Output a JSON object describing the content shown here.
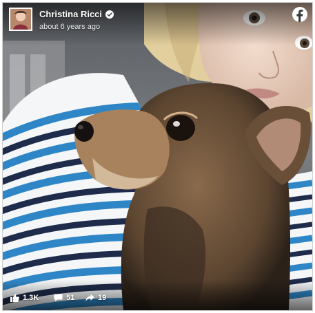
{
  "post": {
    "author_name": "Christina Ricci",
    "timestamp": "about 6 years ago",
    "verified": true,
    "platform_icon": "facebook-icon",
    "photo_description_icon": "photo"
  },
  "stats": {
    "likes": "1.3K",
    "comments": "51",
    "shares": "19"
  },
  "icons": {
    "likes": "thumbs-up-icon",
    "comments": "comment-icon",
    "shares": "share-arrow-icon",
    "verified": "verified-badge-icon"
  },
  "colors": {
    "brand": "#ffffff",
    "stripe_blue": "#2f86c6",
    "stripe_navy": "#1e2b4a"
  }
}
